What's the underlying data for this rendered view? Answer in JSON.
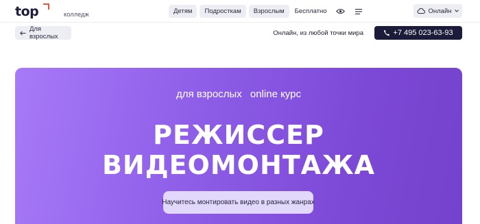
{
  "header": {
    "logo_word": "top",
    "logo_sub": "колледж",
    "nav": [
      {
        "label": "Детям"
      },
      {
        "label": "Подросткам"
      },
      {
        "label": "Взрослым"
      }
    ],
    "nav_free": "Бесплатно",
    "online_button": "Онлайн",
    "icons": {
      "accessibility": "eye-icon",
      "menu": "menu-icon",
      "cloud": "cloud-icon",
      "dropdown": "chevron-down-icon"
    }
  },
  "subheader": {
    "back_label": "Для взрослых",
    "online_note": "Онлайн, из любой точки мира",
    "phone": "+7 495 023-63-93"
  },
  "hero": {
    "tag_audience": "для взрослых",
    "tag_format": "online курс",
    "title_line1": "РЕЖИССЕР",
    "title_line2": "ВИДЕОМОНТАЖА",
    "note": "Научитесь монтировать видео в разных жанрах"
  },
  "colors": {
    "brand_dark": "#1c1c3a",
    "logo_accent": "#e9533b",
    "hero_gradient_start": "#a77af8",
    "hero_gradient_end": "#7442cc",
    "pill_bg": "#eceef3"
  }
}
